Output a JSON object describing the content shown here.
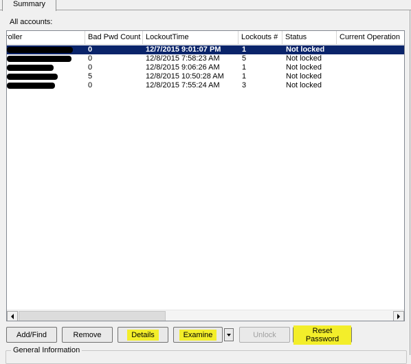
{
  "tabs": [
    {
      "label": "Summary"
    }
  ],
  "caption": "All accounts:",
  "columns": [
    "roller",
    "Bad Pwd Count",
    "LockoutTime",
    "Lockouts #",
    "Status",
    "Current Operation"
  ],
  "rows": [
    {
      "bad_pwd_count": "0",
      "lockout_time": "12/7/2015 9:01:07 PM",
      "lockouts": "1",
      "status": "Not locked",
      "selected": true
    },
    {
      "bad_pwd_count": "0",
      "lockout_time": "12/8/2015 7:58:23 AM",
      "lockouts": "5",
      "status": "Not locked"
    },
    {
      "bad_pwd_count": "0",
      "lockout_time": "12/8/2015 9:06:26 AM",
      "lockouts": "1",
      "status": "Not locked"
    },
    {
      "bad_pwd_count": "5",
      "lockout_time": "12/8/2015 10:50:28 AM",
      "lockouts": "1",
      "status": "Not locked"
    },
    {
      "bad_pwd_count": "0",
      "lockout_time": "12/8/2015 7:55:24 AM",
      "lockouts": "3",
      "status": "Not locked"
    }
  ],
  "buttons": {
    "add_find": "Add/Find",
    "remove": "Remove",
    "details": "Details",
    "examine": "Examine",
    "unlock": "Unlock",
    "reset_password": "Reset Password"
  },
  "highlight_color": "#f3ee2a",
  "selection_color": "#0a246a",
  "group_label": "General Information"
}
